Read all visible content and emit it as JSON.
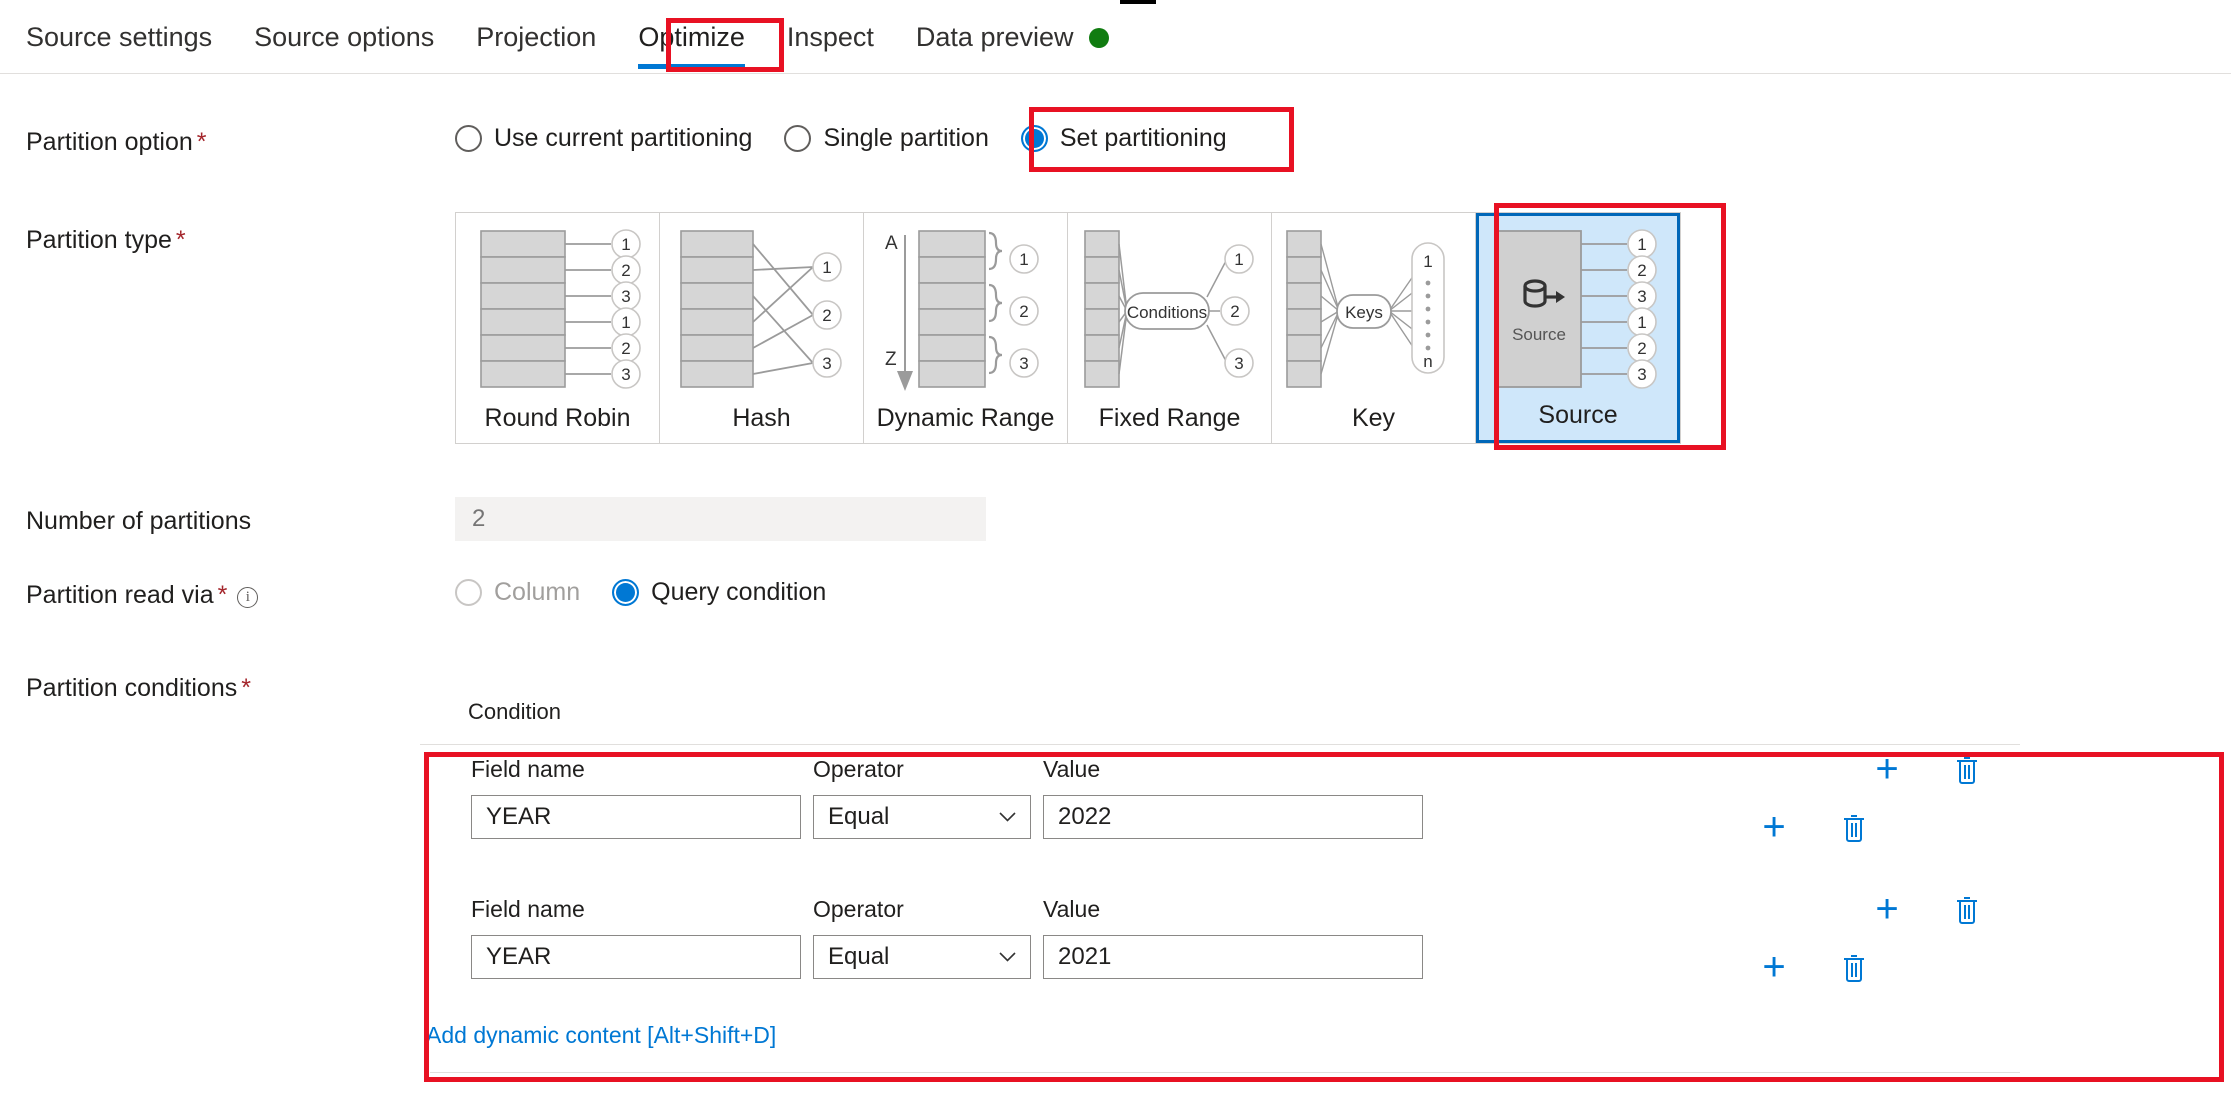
{
  "tabs": [
    {
      "label": "Source settings",
      "active": false
    },
    {
      "label": "Source options",
      "active": false
    },
    {
      "label": "Projection",
      "active": false
    },
    {
      "label": "Optimize",
      "active": true
    },
    {
      "label": "Inspect",
      "active": false
    },
    {
      "label": "Data preview",
      "active": false,
      "dot": true
    }
  ],
  "status_dot_color": "#107c10",
  "accent_color": "#0078d4",
  "annotation_color": "#e81123",
  "partition_option": {
    "label": "Partition option",
    "required": "*",
    "options": [
      {
        "label": "Use current partitioning",
        "checked": false
      },
      {
        "label": "Single partition",
        "checked": false
      },
      {
        "label": "Set partitioning",
        "checked": true
      }
    ]
  },
  "partition_type": {
    "label": "Partition type",
    "required": "*",
    "cards": [
      {
        "name": "Round Robin",
        "selected": false
      },
      {
        "name": "Hash",
        "selected": false
      },
      {
        "name": "Dynamic Range",
        "selected": false,
        "range_start": "A",
        "range_end": "Z",
        "brace_numbers": [
          "1",
          "2",
          "3"
        ]
      },
      {
        "name": "Fixed Range",
        "selected": false,
        "node": "Conditions",
        "numbers": [
          "1",
          "2",
          "3"
        ]
      },
      {
        "name": "Key",
        "selected": false,
        "node": "Keys",
        "range_top": "1",
        "range_bottom": "n"
      },
      {
        "name": "Source",
        "selected": true,
        "icon_label": "Source",
        "numbers": [
          "1",
          "2",
          "3",
          "1",
          "2",
          "3"
        ]
      }
    ],
    "round_robin_numbers": [
      "1",
      "2",
      "3",
      "1",
      "2",
      "3"
    ],
    "hash_numbers": [
      "1",
      "2",
      "3"
    ]
  },
  "number_of_partitions": {
    "label": "Number of partitions",
    "value": "",
    "placeholder": "2"
  },
  "partition_read_via": {
    "label": "Partition read via",
    "required": "*",
    "info_icon": "info-icon",
    "options": [
      {
        "label": "Column",
        "checked": false,
        "disabled": true
      },
      {
        "label": "Query condition",
        "checked": true,
        "disabled": false
      }
    ]
  },
  "partition_conditions": {
    "label": "Partition conditions",
    "required": "*",
    "section_header": "Condition",
    "column_headers": {
      "field_name": "Field name",
      "operator": "Operator",
      "value": "Value"
    },
    "rows": [
      {
        "field_name": "YEAR",
        "operator": "Equal",
        "value": "2022"
      },
      {
        "field_name": "YEAR",
        "operator": "Equal",
        "value": "2021"
      }
    ],
    "add_dynamic_content_link": "Add dynamic content [Alt+Shift+D]",
    "add_icon": "plus-icon",
    "delete_icon": "trash-icon"
  }
}
